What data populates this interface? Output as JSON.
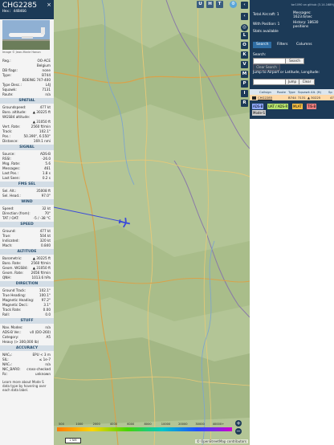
{
  "aircraft": {
    "callsign": "CHG2285",
    "hex_label": "Hex: 44B466",
    "photo_credit": "Image © Jean-Marie Hanon"
  },
  "info": [
    {
      "k": "Reg.:",
      "v": "OO-ACE"
    },
    {
      "k": "",
      "v": "Belgium"
    },
    {
      "k": "DB flags:",
      "v": "none"
    },
    {
      "k": "Type:",
      "v": "B744"
    },
    {
      "k": "",
      "v": "BOEING 747-400"
    },
    {
      "k": "Type Desc.:",
      "v": "L4J"
    },
    {
      "k": "Squawk:",
      "v": "7131"
    },
    {
      "k": "Route:",
      "v": "n/a"
    }
  ],
  "sections": {
    "spatial": "SPATIAL",
    "signal": "SIGNAL",
    "fms": "FMS SEL",
    "wind": "WIND",
    "speed": "SPEED",
    "altitude": "ALTITUDE",
    "direction": "DIRECTION",
    "stuff": "STUFF",
    "accuracy": "ACCURACY"
  },
  "spatial": [
    {
      "k": "Groundspeed:",
      "v": "477 kt"
    },
    {
      "k": "Baro. altitude:",
      "v": "▲ 30225 ft"
    },
    {
      "k": "WGS84 altitude:",
      "v": ""
    },
    {
      "k": "",
      "v": "▲ 31050 ft"
    },
    {
      "k": "Vert. Rate:",
      "v": "2560 ft/min"
    },
    {
      "k": "Track:",
      "v": "102.1°"
    },
    {
      "k": "Pos.:",
      "v": "50.390°, 6.550°"
    },
    {
      "k": "Distance:",
      "v": "169.1 nmi"
    }
  ],
  "signal": [
    {
      "k": "Source:",
      "v": "ADS-B"
    },
    {
      "k": "RSSI:",
      "v": "-26.0"
    },
    {
      "k": "Msg. Rate:",
      "v": "5.6"
    },
    {
      "k": "Messages:",
      "v": "461"
    },
    {
      "k": "Last Pos.:",
      "v": "1.8 s"
    },
    {
      "k": "Last Seen:",
      "v": "0.2 s"
    }
  ],
  "fms": [
    {
      "k": "Sel. Alt.:",
      "v": "35008 ft"
    },
    {
      "k": "Sel. Head.:",
      "v": "97.0°"
    }
  ],
  "wind": [
    {
      "k": "Speed:",
      "v": "32 kt"
    },
    {
      "k": "Direction (from):",
      "v": "70°"
    },
    {
      "k": "TAT / OAT:",
      "v": "-5 / -38 °C"
    }
  ],
  "speed": [
    {
      "k": "Ground:",
      "v": "477 kt"
    },
    {
      "k": "True:",
      "v": "504 kt"
    },
    {
      "k": "Indicated:",
      "v": "320 kt"
    },
    {
      "k": "Mach:",
      "v": "0.840"
    }
  ],
  "altitude": [
    {
      "k": "Barometric:",
      "v": "▲ 30225 ft"
    },
    {
      "k": "Baro. Rate:",
      "v": "2560 ft/min"
    },
    {
      "k": "Geom. WGS84:",
      "v": "▲ 31050 ft"
    },
    {
      "k": "Geom. Rate:",
      "v": "2656 ft/min"
    },
    {
      "k": "QNH:",
      "v": "1013.6 hPa"
    }
  ],
  "direction": [
    {
      "k": "Ground Track:",
      "v": "102.1°"
    },
    {
      "k": "True Heading:",
      "v": "100.1°"
    },
    {
      "k": "Magnetic Heading:",
      "v": "97.2°"
    },
    {
      "k": "Magnetic Decl.:",
      "v": "3.1°"
    },
    {
      "k": "Track Rate:",
      "v": "0.00"
    },
    {
      "k": "Roll:",
      "v": "0.0"
    }
  ],
  "stuff": [
    {
      "k": "Nav. Modes:",
      "v": "n/a"
    },
    {
      "k": "ADS-B Ver.:",
      "v": "v0 (DO-260)"
    },
    {
      "k": "Category:",
      "v": "A5"
    },
    {
      "k": "Heavy (> 300,000 lb)",
      "v": ""
    }
  ],
  "accuracy": [
    {
      "k": "NACₚ:",
      "v": "EPU < 3 m"
    },
    {
      "k": "SIL:",
      "v": "≤ 1e-7"
    },
    {
      "k": "NACᵥ:",
      "v": "n/a"
    },
    {
      "k": "NIC_BARO:",
      "v": "cross-checked"
    },
    {
      "k": "Rc:",
      "v": "unknown"
    }
  ],
  "learn_more": "Learn more about Mode S data type by hovering over each data label.",
  "map": {
    "top_buttons": [
      "U",
      "H",
      "T"
    ],
    "side_buttons": [
      "L",
      "O",
      "K",
      "V",
      "M",
      "P",
      "I",
      "R"
    ],
    "colorbar_labels": [
      "500",
      "1000",
      "2000",
      "4000",
      "6000",
      "8000",
      "10000",
      "20000",
      "30000",
      "40000+"
    ],
    "scale_label": "2 NM",
    "attribution": "© OpenStreetMap contributors",
    "zoom_in": "+",
    "zoom_out": "−"
  },
  "stats": {
    "clear_link": "tar1090 on github (3.14.1689)",
    "total_label": "Total Aircraft: 1",
    "with_pos_label": "With Position: 1",
    "stats_available": "Stats available",
    "messages_label": "Messages:",
    "messages_value": "1623.6/sec",
    "history_label": "History: 18630",
    "history_value": "positions"
  },
  "tabs": [
    "Search",
    "Filters",
    "Columns"
  ],
  "search": {
    "label": "Search:",
    "button": "Search",
    "clear_route": "Clear Search",
    "jump_label": "Jump to Airport or Latitude, Longitude:",
    "jump_button": "Jump",
    "clear_button": "Clear"
  },
  "table": {
    "headers": [
      "Callsign",
      "Route",
      "Type",
      "Squawk",
      "Alt. (ft)",
      "Sp"
    ],
    "row": [
      "CHG2285",
      "",
      "B744",
      "7131",
      "▲ 30225",
      "47"
    ]
  },
  "sources": {
    "adsb": "ADS-B",
    "uat": "UAT / ADS-R",
    "mlat": "MLAT",
    "tisb": "TIS-B",
    "modes": "Mode-S"
  }
}
